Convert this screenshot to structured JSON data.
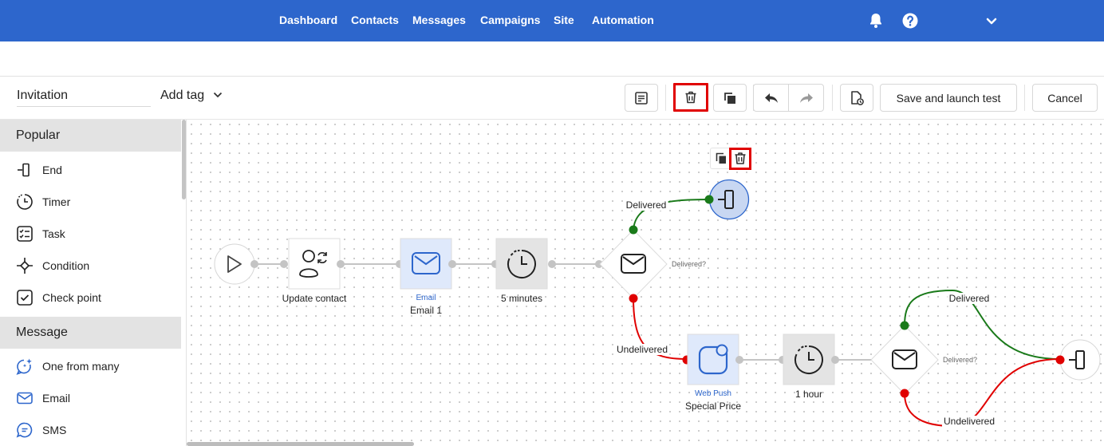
{
  "nav": {
    "items": [
      "Dashboard",
      "Contacts",
      "Messages",
      "Campaigns",
      "Site",
      "Automation"
    ],
    "icons": [
      "bell-icon",
      "help-icon",
      "chevron-down-icon"
    ]
  },
  "toolbar": {
    "title": "Invitation",
    "add_tag": "Add tag",
    "save_launch": "Save and launch test",
    "cancel": "Cancel"
  },
  "sidebar": {
    "sections": [
      {
        "title": "Popular",
        "items": [
          {
            "label": "End",
            "icon": "end-icon"
          },
          {
            "label": "Timer",
            "icon": "timer-icon"
          },
          {
            "label": "Task",
            "icon": "task-icon"
          },
          {
            "label": "Condition",
            "icon": "condition-icon"
          },
          {
            "label": "Check point",
            "icon": "checkpoint-icon"
          }
        ]
      },
      {
        "title": "Message",
        "items": [
          {
            "label": "One from many",
            "icon": "sparkle-chat-icon"
          },
          {
            "label": "Email",
            "icon": "email-icon"
          },
          {
            "label": "SMS",
            "icon": "sms-icon"
          }
        ]
      }
    ]
  },
  "flow": {
    "update_contact": "Update contact",
    "email_type": "Email",
    "email_name": "Email 1",
    "timer1": "5 minutes",
    "delivered_q": "Delivered?",
    "delivered": "Delivered",
    "undelivered": "Undelivered",
    "webpush_type": "Web Push",
    "webpush_name": "Special Price",
    "timer2": "1 hour",
    "delivered_q2": "Delivered?",
    "delivered2": "Delivered",
    "undelivered2": "Undelivered"
  },
  "colors": {
    "nav_bg": "#2d66cc",
    "delivered": "#1a7a1a",
    "undelivered": "#e00000",
    "highlight": "#e00000"
  }
}
